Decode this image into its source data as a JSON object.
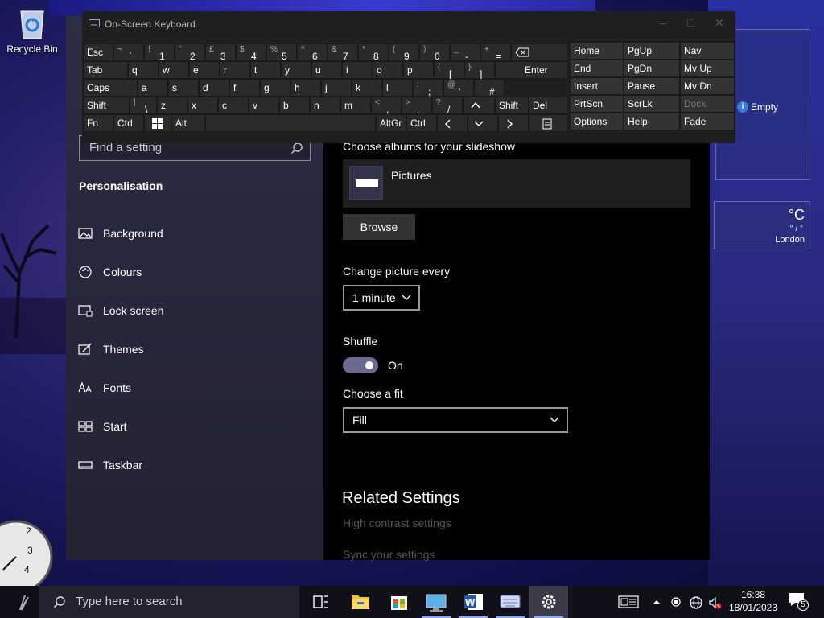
{
  "desktop": {
    "recycle_bin_label": "Recycle Bin"
  },
  "osk": {
    "title": "On-Screen Keyboard",
    "rows": {
      "row1": [
        {
          "top": "¬",
          "main": "`"
        },
        {
          "top": "!",
          "main": "1"
        },
        {
          "top": "\"",
          "main": "2"
        },
        {
          "top": "£",
          "main": "3"
        },
        {
          "top": "$",
          "main": "4"
        },
        {
          "top": "%",
          "main": "5"
        },
        {
          "top": "^",
          "main": "6"
        },
        {
          "top": "&",
          "main": "7"
        },
        {
          "top": "*",
          "main": "8"
        },
        {
          "top": "(",
          "main": "9"
        },
        {
          "top": ")",
          "main": "0"
        },
        {
          "top": "_",
          "main": "-"
        },
        {
          "top": "+",
          "main": "="
        }
      ],
      "row2_letters": [
        "q",
        "w",
        "e",
        "r",
        "t",
        "y",
        "u",
        "i",
        "o",
        "p"
      ],
      "row2_brackets": [
        {
          "top": "{",
          "main": "["
        },
        {
          "top": "}",
          "main": "]"
        }
      ],
      "row3_letters": [
        "a",
        "s",
        "d",
        "f",
        "g",
        "h",
        "j",
        "k",
        "l"
      ],
      "row3_punct": [
        {
          "top": ":",
          "main": ";"
        },
        {
          "top": "@",
          "main": "'"
        },
        {
          "top": "~",
          "main": "#"
        }
      ],
      "row4_letters": [
        "z",
        "x",
        "c",
        "v",
        "b",
        "n",
        "m"
      ],
      "row4_punct": [
        {
          "top": "|",
          "main": "\\"
        },
        {
          "top": "<",
          "main": ","
        },
        {
          "top": ">",
          "main": "."
        },
        {
          "top": "?",
          "main": "/"
        }
      ]
    },
    "keys": {
      "esc": "Esc",
      "tab": "Tab",
      "caps": "Caps",
      "shift_left": "Shift",
      "shift_right": "Shift",
      "fn": "Fn",
      "ctrl_left": "Ctrl",
      "alt": "Alt",
      "altgr": "AltGr",
      "ctrl_right": "Ctrl",
      "enter": "Enter",
      "del": "Del",
      "home": "Home",
      "pgup": "PgUp",
      "nav": "Nav",
      "end": "End",
      "pgdn": "PgDn",
      "mvup": "Mv Up",
      "insert": "Insert",
      "pause": "Pause",
      "mvdn": "Mv Dn",
      "prtscn": "PrtScn",
      "scrlk": "ScrLk",
      "dock": "Dock",
      "options": "Options",
      "help": "Help",
      "fade": "Fade"
    }
  },
  "settings": {
    "search_placeholder": "Find a setting",
    "section_title": "Personalisation",
    "nav": [
      {
        "label": "Background",
        "icon": "image-icon"
      },
      {
        "label": "Colours",
        "icon": "palette-icon"
      },
      {
        "label": "Lock screen",
        "icon": "lock-screen-icon"
      },
      {
        "label": "Themes",
        "icon": "themes-icon"
      },
      {
        "label": "Fonts",
        "icon": "fonts-icon"
      },
      {
        "label": "Start",
        "icon": "start-icon"
      },
      {
        "label": "Taskbar",
        "icon": "taskbar-icon"
      }
    ],
    "choose_albums_label": "Choose albums for your slideshow",
    "album_name": "Pictures",
    "browse_label": "Browse",
    "change_picture_label": "Change picture every",
    "change_picture_value": "1 minute",
    "shuffle_label": "Shuffle",
    "shuffle_state": "On",
    "choose_fit_label": "Choose a fit",
    "choose_fit_value": "Fill",
    "related_settings_heading": "Related Settings",
    "related_links": [
      "High contrast settings",
      "Sync your settings"
    ]
  },
  "widgets": {
    "info_text": "Empty",
    "weather_unit": "°C",
    "weather_range": "° / °",
    "weather_city": "London"
  },
  "taskbar": {
    "search_placeholder": "Type here to search",
    "time": "16:38",
    "date": "18/01/2023",
    "notification_count": "5",
    "apps": [
      "task-view-icon",
      "file-explorer-icon",
      "store-icon",
      "remote-desktop-icon",
      "word-icon",
      "osk-icon",
      "settings-icon"
    ]
  },
  "colors": {
    "accent": "#8aa8ff",
    "toggle_on": "#6b6b92"
  }
}
